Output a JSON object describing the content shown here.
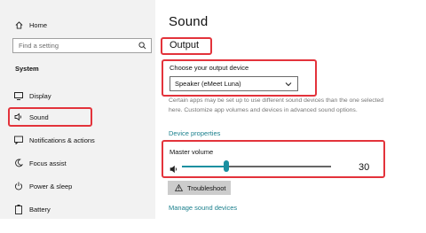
{
  "sidebar": {
    "home_label": "Home",
    "search_placeholder": "Find a setting",
    "section_title": "System",
    "items": [
      {
        "label": "Display",
        "icon": "display-icon"
      },
      {
        "label": "Sound",
        "icon": "speaker-icon"
      },
      {
        "label": "Notifications & actions",
        "icon": "notifications-icon"
      },
      {
        "label": "Focus assist",
        "icon": "moon-icon"
      },
      {
        "label": "Power & sleep",
        "icon": "power-icon"
      },
      {
        "label": "Battery",
        "icon": "battery-icon"
      }
    ]
  },
  "main": {
    "title": "Sound",
    "section_heading": "Output",
    "device_label": "Choose your output device",
    "device_selected": "Speaker (eMeet Luna)",
    "description": "Certain apps may be set up to use different sound devices than the one selected here. Customize app volumes and devices in advanced sound options.",
    "device_properties_link": "Device properties",
    "volume_label": "Master volume",
    "volume_value": "30",
    "volume_level": 0.3,
    "troubleshoot_label": "Troubleshoot",
    "manage_devices_link": "Manage sound devices"
  },
  "colors": {
    "accent": "#1a8fa0",
    "highlight": "#e3333b",
    "sidebar_bg": "#f2f2f2"
  }
}
